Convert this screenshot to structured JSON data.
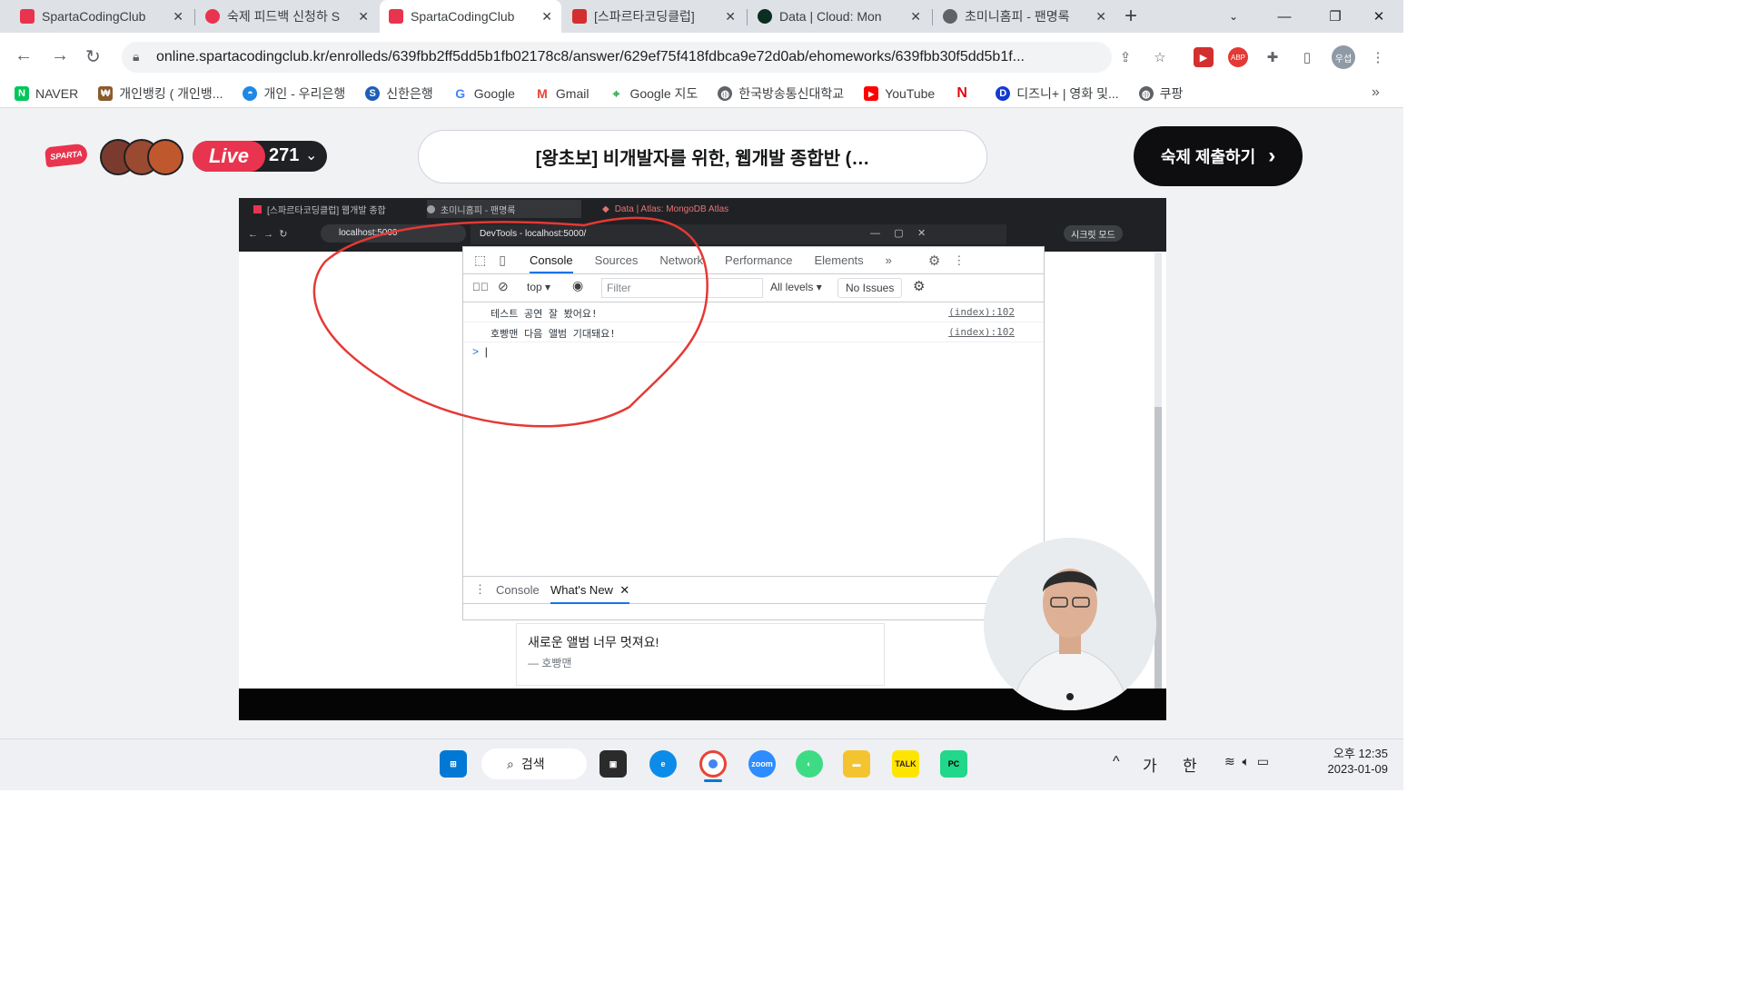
{
  "browser": {
    "tabs": [
      {
        "title": "SpartaCodingClub",
        "color": "#e8344e"
      },
      {
        "title": "숙제 피드백 신청하 S",
        "color": "#e8344e"
      },
      {
        "title": "SpartaCodingClub",
        "color": "#e8344e"
      },
      {
        "title": "[스파르타코딩클럽]",
        "color": "#e8344e"
      },
      {
        "title": "Data | Cloud: Mon",
        "color": "#13aa52"
      },
      {
        "title": "초미니홈피 - 팬명록",
        "color": "#5f6368"
      }
    ],
    "new_tab": "+",
    "url": "online.spartacodingclub.kr/enrolleds/639fbb2ff5dd5b1fb02178c8/answer/629ef75f418fdbca9e72d0ab/ehomeworks/639fbb30f5dd5b1f...",
    "profile_label": "우섭",
    "bookmarks": [
      {
        "label": "NAVER",
        "color": "#03c75a",
        "icon": "N"
      },
      {
        "label": "개인뱅킹 ( 개인뱅...",
        "color": "#8b5a2b",
        "icon": "₩"
      },
      {
        "label": "개인 - 우리은행",
        "color": "#1e88e5",
        "icon": "◓"
      },
      {
        "label": "신한은행",
        "color": "#1e5eb8",
        "icon": "S"
      },
      {
        "label": "Google",
        "color": "#4285f4",
        "icon": "G"
      },
      {
        "label": "Gmail",
        "color": "#ea4335",
        "icon": "M"
      },
      {
        "label": "Google 지도",
        "color": "#34a853",
        "icon": "⌖"
      },
      {
        "label": "한국방송통신대학교",
        "color": "#5f6368",
        "icon": "◍"
      },
      {
        "label": "YouTube",
        "color": "#ff0000",
        "icon": "▶"
      },
      {
        "label": "",
        "color": "#e50914",
        "icon": "N"
      },
      {
        "label": "디즈니+ | 영화 및...",
        "color": "#113ccf",
        "icon": "D"
      },
      {
        "label": "쿠팡",
        "color": "#5f6368",
        "icon": "◍"
      }
    ],
    "bookmarks_more": "»"
  },
  "page": {
    "logo": "SPARTA",
    "live_label": "Live",
    "live_count": "271",
    "course_title": "[왕초보] 비개발자를 위한, 웹개발 종합반 (…",
    "submit_label": "숙제 제출하기",
    "submit_arrow": "›"
  },
  "video": {
    "tabs": [
      "[스파르타코딩클럽] 웹개발 종합",
      "초미니홈피 - 팬명록",
      "Data | Atlas: MongoDB Atlas"
    ],
    "url": "localhost:5000",
    "devtools_title": "DevTools - localhost:5000/",
    "incognito": "시크릿 모드",
    "devtools": {
      "tabs": [
        "Console",
        "Sources",
        "Network",
        "Performance",
        "Elements"
      ],
      "active_tab": "Console",
      "context": "top",
      "filter_placeholder": "Filter",
      "levels": "All levels",
      "issues": "No Issues",
      "logs": [
        {
          "message": "테스트 공연 잘 봤어요!",
          "source": "(index):102"
        },
        {
          "message": "호빵맨 다음 앨범 기대돼요!",
          "source": "(index):102"
        }
      ],
      "prompt": ">",
      "drawer_tabs": [
        "Console",
        "What's New"
      ]
    },
    "card": {
      "text": "새로운 앨범 너무 멋져요!",
      "author": "— 호빵맨"
    }
  },
  "taskbar": {
    "search_label": "검색",
    "ime_1": "가",
    "ime_2": "한",
    "time": "오후 12:35",
    "date": "2023-01-09",
    "chevron": "^"
  }
}
